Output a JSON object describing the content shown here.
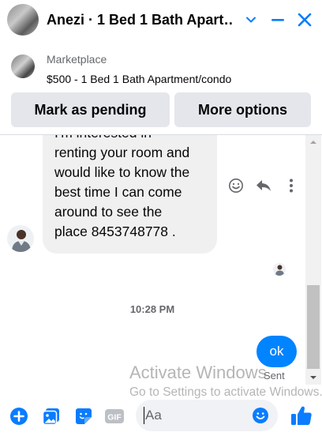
{
  "header": {
    "title": "Anezi · 1 Bed 1 Bath Apart…",
    "avatar_icon": "user-avatar",
    "minimize_icon": "minus-icon",
    "close_icon": "close-icon",
    "options_icon": "chevron-down-icon"
  },
  "marketplace": {
    "label": "Marketplace",
    "listing_title": "$500 - 1 Bed 1 Bath Apartment/condo"
  },
  "actions": {
    "mark_pending_label": "Mark as pending",
    "more_options_label": "More options"
  },
  "messages": {
    "incoming": {
      "line1": "I'm interested in",
      "line2": "renting your room and",
      "line3": "would like to know the",
      "line4": "best time I can come",
      "line5": "around to see the",
      "line6": "place 8453748778 ."
    },
    "timestamp": "10:28 PM",
    "outgoing": {
      "text": "ok",
      "status": "Sent"
    }
  },
  "watermark": {
    "line1": "Activate Windows",
    "line2": "Go to Settings to activate Windows."
  },
  "composer": {
    "placeholder": "Aa",
    "icons": [
      "plus-circle-icon",
      "photo-icon",
      "sticker-icon",
      "gif-icon",
      "emoji-icon",
      "thumbs-up-icon"
    ]
  },
  "colors": {
    "accent": "#0084ff",
    "icon_blue": "#0a7cff",
    "button_bg": "#e4e6eb",
    "bubble_in": "#f0f0f0",
    "secondary_text": "#65676b"
  }
}
